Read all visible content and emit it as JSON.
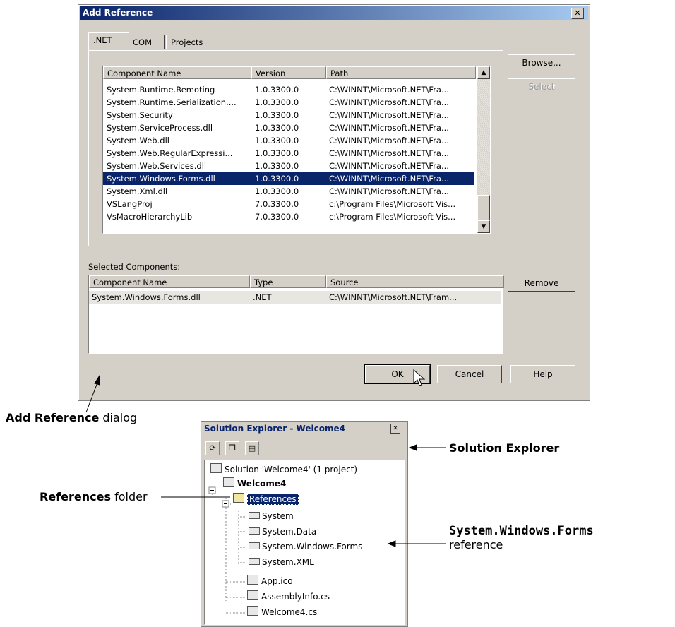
{
  "dialog": {
    "title": "Add Reference",
    "close_glyph": "✕",
    "tabs": [
      ".NET",
      "COM",
      "Projects"
    ],
    "columns": [
      "Component Name",
      "Version",
      "Path"
    ],
    "rows": [
      [
        "System.Runtime.Remoting",
        "1.0.3300.0",
        "C:\\WINNT\\Microsoft.NET\\Fra..."
      ],
      [
        "System.Runtime.Serialization....",
        "1.0.3300.0",
        "C:\\WINNT\\Microsoft.NET\\Fra..."
      ],
      [
        "System.Security",
        "1.0.3300.0",
        "C:\\WINNT\\Microsoft.NET\\Fra..."
      ],
      [
        "System.ServiceProcess.dll",
        "1.0.3300.0",
        "C:\\WINNT\\Microsoft.NET\\Fra..."
      ],
      [
        "System.Web.dll",
        "1.0.3300.0",
        "C:\\WINNT\\Microsoft.NET\\Fra..."
      ],
      [
        "System.Web.RegularExpressi...",
        "1.0.3300.0",
        "C:\\WINNT\\Microsoft.NET\\Fra..."
      ],
      [
        "System.Web.Services.dll",
        "1.0.3300.0",
        "C:\\WINNT\\Microsoft.NET\\Fra..."
      ],
      [
        "System.Windows.Forms.dll",
        "1.0.3300.0",
        "C:\\WINNT\\Microsoft.NET\\Fra..."
      ],
      [
        "System.Xml.dll",
        "1.0.3300.0",
        "C:\\WINNT\\Microsoft.NET\\Fra..."
      ],
      [
        "VSLangProj",
        "7.0.3300.0",
        "c:\\Program Files\\Microsoft Vis..."
      ],
      [
        "VsMacroHierarchyLib",
        "7.0.3300.0",
        "c:\\Program Files\\Microsoft Vis..."
      ]
    ],
    "selected_row_index": 7,
    "browse_label": "Browse...",
    "select_label": "Select",
    "selected_components_label": "Selected Components:",
    "selected_columns": [
      "Component Name",
      "Type",
      "Source"
    ],
    "selected_rows": [
      [
        "System.Windows.Forms.dll",
        ".NET",
        "C:\\WINNT\\Microsoft.NET\\Fram..."
      ]
    ],
    "remove_label": "Remove",
    "ok_label": "OK",
    "cancel_label": "Cancel",
    "help_label": "Help"
  },
  "solution_explorer": {
    "title": "Solution Explorer - Welcome4",
    "close_glyph": "✕",
    "solution_label": "Solution 'Welcome4' (1 project)",
    "project_label": "Welcome4",
    "references_label": "References",
    "references": [
      "System",
      "System.Data",
      "System.Windows.Forms",
      "System.XML"
    ],
    "files": [
      "App.ico",
      "AssemblyInfo.cs",
      "Welcome4.cs"
    ]
  },
  "annotations": {
    "add_reference_bold": "Add Reference",
    "add_reference_rest": " dialog",
    "solution_explorer": "Solution Explorer",
    "references_bold": "References",
    "references_rest": " folder",
    "swf_code": "System.Windows.Forms",
    "swf_rest": "reference"
  }
}
